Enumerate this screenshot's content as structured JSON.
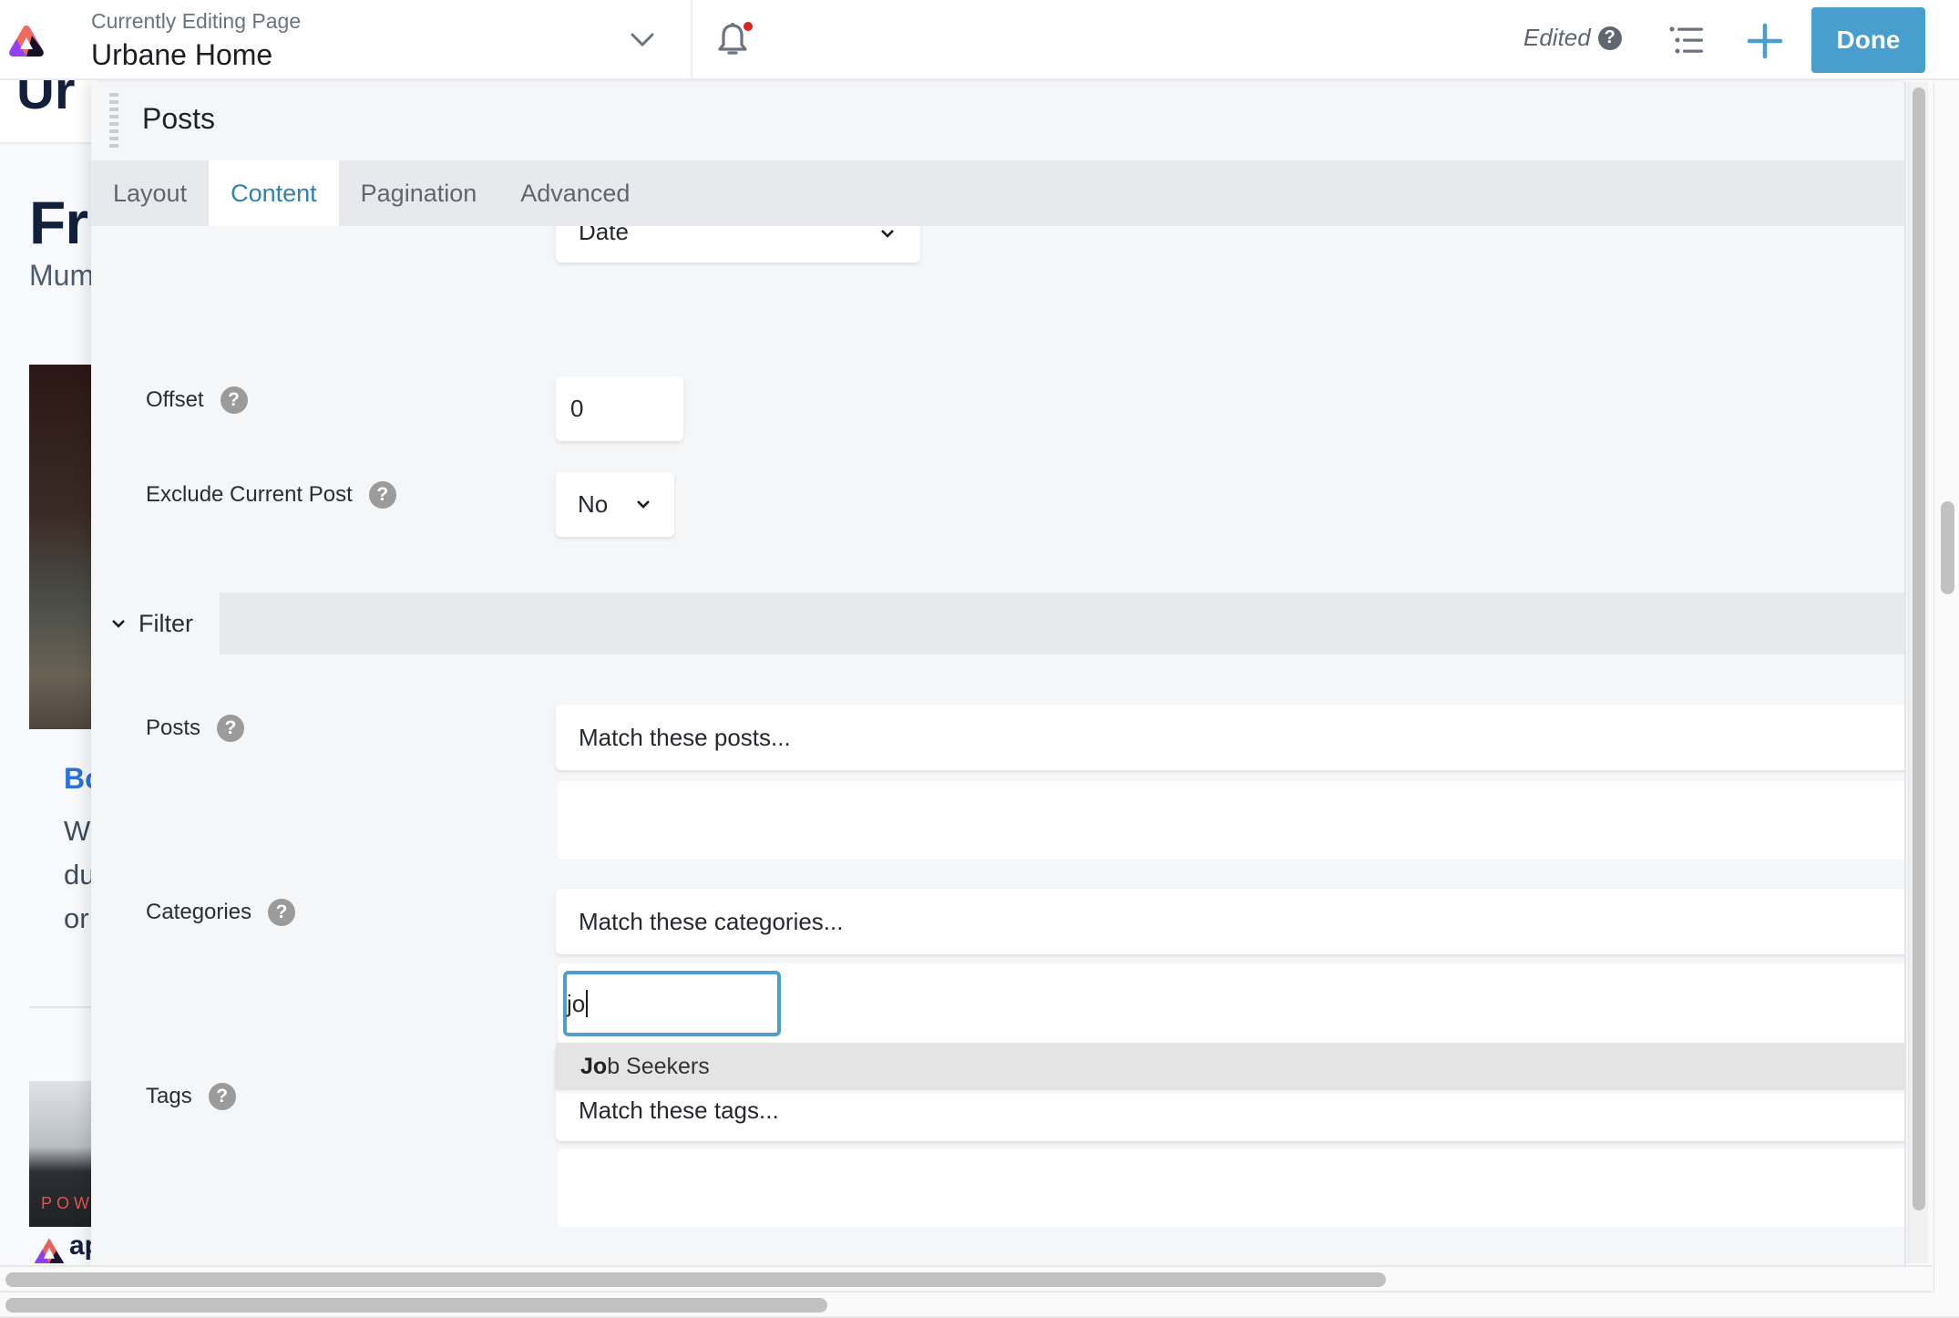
{
  "topbar": {
    "editing_label": "Currently Editing Page",
    "page_name": "Urbane Home",
    "status": "Edited",
    "done_label": "Done",
    "notification_dot_color": "#d6261e",
    "accent_color": "#489ecd"
  },
  "background_page": {
    "header_fragment": "Ur",
    "title_fragment": "Fr",
    "subtitle_fragment": "Mum",
    "link_fragment": "Bo",
    "body_fragment_lines": [
      "W",
      "du",
      "or"
    ],
    "image_text_fragment": "POW",
    "footer_logo_fragment": "ap"
  },
  "panel": {
    "title": "Posts",
    "tabs": [
      {
        "label": "Layout",
        "active": false
      },
      {
        "label": "Content",
        "active": true
      },
      {
        "label": "Pagination",
        "active": false
      },
      {
        "label": "Advanced",
        "active": false
      }
    ],
    "fields": {
      "order_by": {
        "value": "Date"
      },
      "offset": {
        "label": "Offset",
        "value": "0"
      },
      "exclude_current_post": {
        "label": "Exclude Current Post",
        "value": "No"
      }
    },
    "filter_section": {
      "label": "Filter",
      "posts": {
        "label": "Posts",
        "placeholder": "Match these posts..."
      },
      "categories": {
        "label": "Categories",
        "placeholder": "Match these categories...",
        "search_value": "jo",
        "suggestion": {
          "match": "Jo",
          "rest": "b Seekers"
        }
      },
      "tags": {
        "label": "Tags",
        "placeholder": "Match these tags..."
      }
    }
  }
}
